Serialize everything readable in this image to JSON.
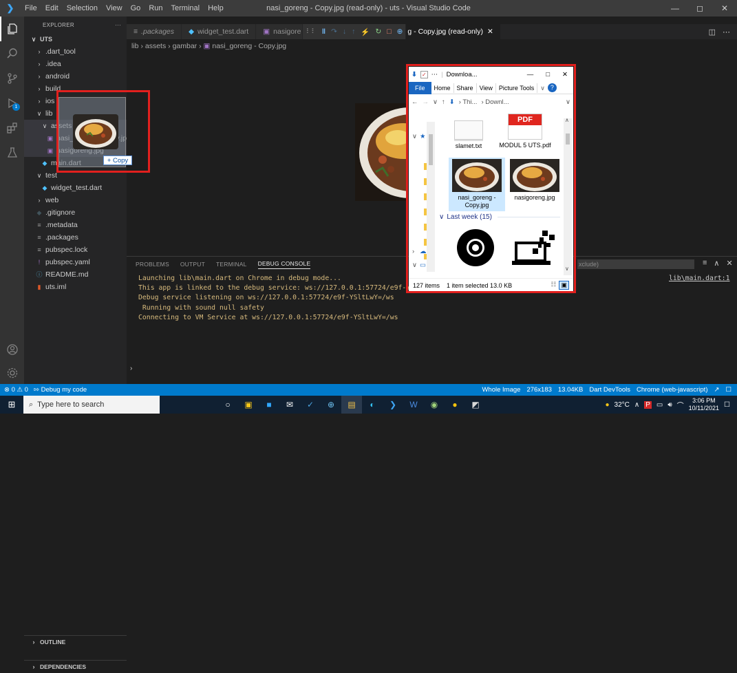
{
  "titlebar": {
    "menu": [
      "File",
      "Edit",
      "Selection",
      "View",
      "Go",
      "Run",
      "Terminal",
      "Help"
    ],
    "window_title": "nasi_goreng - Copy.jpg (read-only) - uts - Visual Studio Code",
    "controls": {
      "minimize": "—",
      "maximize": "◻",
      "close": "✕"
    }
  },
  "activity_bar": {
    "icons": [
      "files-icon",
      "search-icon",
      "source-control-icon",
      "run-debug-icon",
      "extensions-icon",
      "testing-icon"
    ],
    "badge": "1",
    "bottom_icons": [
      "account-icon",
      "manage-gear-icon"
    ]
  },
  "explorer": {
    "header": "EXPLORER",
    "more": "···",
    "root": "UTS",
    "items": [
      {
        "label": ".dart_tool",
        "type": "folder-collapsed",
        "indent": 1
      },
      {
        "label": ".idea",
        "type": "folder-collapsed",
        "indent": 1
      },
      {
        "label": "android",
        "type": "folder-collapsed",
        "indent": 1
      },
      {
        "label": "build",
        "type": "folder-collapsed",
        "indent": 1
      },
      {
        "label": "ios",
        "type": "folder-collapsed",
        "indent": 1
      },
      {
        "label": "lib",
        "type": "folder-expanded",
        "indent": 1
      },
      {
        "label": "assets",
        "type": "folder-expanded",
        "indent": 2
      },
      {
        "label": "nasi_goreng - Copy.jpg",
        "type": "image",
        "indent": 3
      },
      {
        "label": "nasigoreng.jpg",
        "type": "image",
        "indent": 3
      },
      {
        "label": "main.dart",
        "type": "dart",
        "indent": 2
      },
      {
        "label": "test",
        "type": "folder-expanded",
        "indent": 1
      },
      {
        "label": "widget_test.dart",
        "type": "dart",
        "indent": 2
      },
      {
        "label": "web",
        "type": "folder-collapsed",
        "indent": 1
      },
      {
        "label": ".gitignore",
        "type": "git",
        "indent": 1
      },
      {
        "label": ".metadata",
        "type": "list",
        "indent": 1
      },
      {
        "label": ".packages",
        "type": "list",
        "indent": 1
      },
      {
        "label": "pubspec.lock",
        "type": "list",
        "indent": 1
      },
      {
        "label": "pubspec.yaml",
        "type": "yaml",
        "indent": 1
      },
      {
        "label": "README.md",
        "type": "info",
        "indent": 1
      },
      {
        "label": "uts.iml",
        "type": "iml",
        "indent": 1
      }
    ],
    "outline": "OUTLINE",
    "dependencies": "DEPENDENCIES"
  },
  "drag": {
    "copy_label": "+ Copy"
  },
  "tabs": [
    {
      "label": ".packages",
      "icon": "list-icon",
      "active": false,
      "italic": true
    },
    {
      "label": "widget_test.dart",
      "icon": "dart-icon",
      "active": false,
      "italic": false
    },
    {
      "label": "nasigore",
      "icon": "image-icon",
      "active": false,
      "italic": false
    },
    {
      "label": "g - Copy.jpg (read-only)",
      "icon": "",
      "active": true,
      "italic": false,
      "close": "✕"
    }
  ],
  "debug_toolbar": {
    "icons": [
      "drag-grip-icon",
      "pause-icon",
      "step-over-icon",
      "step-into-icon",
      "step-out-icon",
      "hot-reload-icon",
      "restart-icon",
      "stop-icon",
      "inspect-icon"
    ]
  },
  "editor_actions": [
    "split-editor-icon",
    "more-actions-icon"
  ],
  "breadcrumb": [
    "lib",
    "assets",
    "gambar",
    "nasi_goreng - Copy.jpg"
  ],
  "panel": {
    "tabs": [
      "PROBLEMS",
      "OUTPUT",
      "TERMINAL",
      "DEBUG CONSOLE"
    ],
    "active_tab": "DEBUG CONSOLE",
    "filter_text": "xclude)",
    "source_link": "lib\\main.dart:1",
    "lines": [
      {
        "text": "Launching lib\\main.dart on Chrome in debug mode...",
        "color": "#d7ba7d"
      },
      {
        "text": "This app is linked to the debug service: ws://127.0.0.1:57724/e9f-YSltLwY=/ws",
        "color": "#d7ba7d"
      },
      {
        "text": "Debug service listening on ws://127.0.0.1:57724/e9f-YSltLwY=/ws",
        "color": "#d7ba7d"
      },
      {
        "text": " Running with sound null safety",
        "color": "#d7ba7d"
      },
      {
        "text": "Connecting to VM Service at ws://127.0.0.1:57724/e9f-YSltLwY=/ws",
        "color": "#d7ba7d"
      }
    ],
    "actions": [
      "≡",
      "∧",
      "✕"
    ]
  },
  "statusbar": {
    "errors": "⊗ 0",
    "warnings": "⚠ 0",
    "debug": "Debug my code",
    "whole_image": "Whole Image",
    "dimensions": "276x183",
    "size": "13.04KB",
    "devtools": "Dart DevTools",
    "device": "Chrome (web-javascript)"
  },
  "file_explorer": {
    "title": "Downloa...",
    "ribbon": [
      "File",
      "Home",
      "Share",
      "View",
      "Picture Tools"
    ],
    "address": [
      "Thi...",
      "Downl..."
    ],
    "items": [
      {
        "label": "slamet.txt",
        "kind": "txt"
      },
      {
        "label": "MODUL 5 UTS.pdf",
        "kind": "pdf"
      },
      {
        "label": "nasi_goreng - Copy.jpg",
        "kind": "photo",
        "selected": true
      },
      {
        "label": "nasigoreng.jpg",
        "kind": "photo",
        "selected": false
      },
      {
        "label": "",
        "kind": "camera"
      },
      {
        "label": "",
        "kind": "laptop"
      }
    ],
    "group_header": "Last week (15)",
    "status_count": "127 items",
    "status_selected": "1 item selected  13.0 KB",
    "pdf_badge": "PDF"
  },
  "taskbar": {
    "search_placeholder": "Type here to search",
    "weather": "32°C",
    "time": "3:06 PM",
    "date": "10/11/2021"
  },
  "colors": {
    "accent": "#007acc",
    "highlight": "#e2201e",
    "console": "#d7ba7d",
    "link": "#cccccc"
  }
}
